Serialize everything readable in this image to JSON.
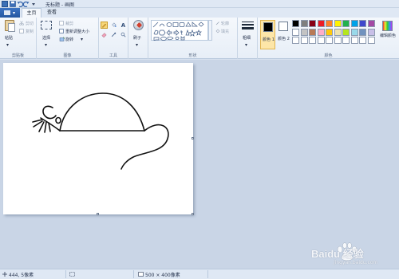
{
  "titlebar": {
    "title": "无标题 - 画图"
  },
  "tabs": {
    "home": "主页",
    "view": "查看"
  },
  "clipboard": {
    "paste": "粘贴",
    "cut": "剪切",
    "copy": "复制",
    "group_label": "剪贴板"
  },
  "image": {
    "select": "选择",
    "crop": "裁剪",
    "resize": "重新调整大小",
    "rotate": "旋转",
    "group_label": "图像"
  },
  "tools": {
    "group_label": "工具",
    "text_tool": "A"
  },
  "brushes": {
    "label": "刷子"
  },
  "shapes": {
    "outline": "轮廓",
    "fill": "填充",
    "group_label": "形状"
  },
  "size": {
    "label": "粗细"
  },
  "colors": {
    "color1_label": "颜色 1",
    "color2_label": "颜色 2",
    "edit_label": "编辑颜色",
    "group_label": "颜色",
    "color1_value": "#000000",
    "color2_value": "#ffffff",
    "palette_row1": [
      "#000000",
      "#7f7f7f",
      "#880015",
      "#ed1c24",
      "#ff7f27",
      "#fff200",
      "#22b14c",
      "#00a2e8",
      "#3f48cc",
      "#a349a4"
    ],
    "palette_row2": [
      "#ffffff",
      "#c3c3c3",
      "#b97a57",
      "#ffaec9",
      "#ffc90e",
      "#efe4b0",
      "#b5e61d",
      "#99d9ea",
      "#7092be",
      "#c8bfe7"
    ],
    "palette_row3": [
      "#ffffff",
      "#ffffff",
      "#ffffff",
      "#ffffff",
      "#ffffff",
      "#ffffff",
      "#ffffff",
      "#ffffff",
      "#ffffff",
      "#ffffff"
    ]
  },
  "status": {
    "cursor_pos": "444, 5像素",
    "canvas_size": "500 × 400像素"
  },
  "watermark": {
    "text": "Baidu 经验",
    "url": "jingyan.baidu.com"
  }
}
